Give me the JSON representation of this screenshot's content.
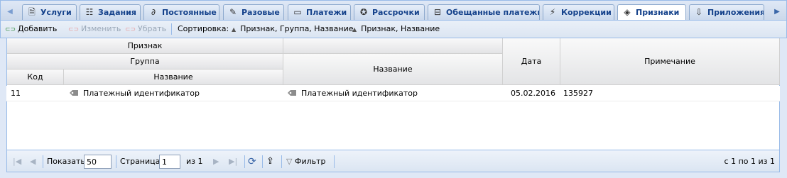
{
  "tabs": [
    {
      "label": "Услуги",
      "icon": "receipt-icon"
    },
    {
      "label": "Задания",
      "icon": "task-icon"
    },
    {
      "label": "Постоянные",
      "icon": "link-icon"
    },
    {
      "label": "Разовые",
      "icon": "wrench-icon"
    },
    {
      "label": "Платежи",
      "icon": "card-icon"
    },
    {
      "label": "Рассрочки",
      "icon": "lifebuoy-icon"
    },
    {
      "label": "Обещанные платежи",
      "icon": "promise-icon"
    },
    {
      "label": "Коррекции",
      "icon": "wand-icon"
    },
    {
      "label": "Признаки",
      "icon": "tag-icon",
      "active": true
    },
    {
      "label": "Приложения",
      "icon": "attachment-icon"
    }
  ],
  "toolbar": {
    "add": "Добавить",
    "edit": "Изменить",
    "remove": "Убрать",
    "sort_label": "Сортировка:",
    "sort_1": "Признак, Группа, Название",
    "sort_2": "Признак, Название"
  },
  "grid": {
    "headers": {
      "attribute": "Признак",
      "group": "Группа",
      "code": "Код",
      "group_name": "Название",
      "name": "Название",
      "date": "Дата",
      "note": "Примечание"
    },
    "rows": [
      {
        "code": "11",
        "group_name": "Платежный идентификатор",
        "name": "Платежный идентификатор",
        "date": "05.02.2016",
        "note": "135927"
      }
    ]
  },
  "pager": {
    "show_label": "Показать",
    "page_size": "50",
    "page_label": "Страница",
    "page": "1",
    "of_label": "из 1",
    "filter": "Фильтр",
    "summary": "с 1 по 1 из 1"
  },
  "colors": {
    "accent": "#15428b",
    "border": "#99bbe8",
    "add_green": "#2e8b3c"
  }
}
